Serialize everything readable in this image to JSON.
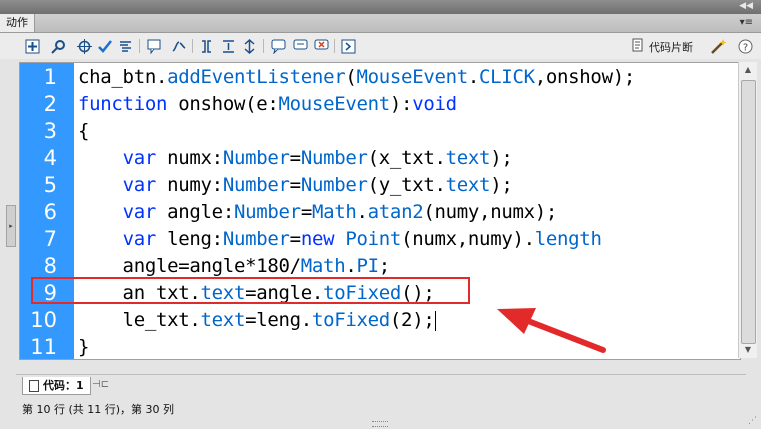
{
  "panel": {
    "tab_label": "动作",
    "title_arrows": "◀◀",
    "menu_icon": "▾≡"
  },
  "toolbar": {
    "icons": [
      "add-icon",
      "find-icon",
      "target-icon",
      "check-syntax-icon",
      "auto-format-icon",
      "code-hint-icon",
      "debug-options-icon",
      "collapse-braces-icon",
      "collapse-selection-icon",
      "expand-all-icon",
      "apply-block-comment-icon",
      "apply-line-comment-icon",
      "remove-comment-icon",
      "show-hide-toolbox-icon"
    ],
    "snippet_label": "代码片断",
    "wand_icon": "wand-icon",
    "help_icon": "help-icon"
  },
  "editor": {
    "lines": [
      {
        "num": "1",
        "tokens": [
          [
            "pl",
            "cha_btn."
          ],
          [
            "fn",
            "addEventListener"
          ],
          [
            "pl",
            "("
          ],
          [
            "fn",
            "MouseEvent"
          ],
          [
            "pl",
            "."
          ],
          [
            "fn",
            "CLICK"
          ],
          [
            "pl",
            ",onshow);"
          ]
        ]
      },
      {
        "num": "2",
        "tokens": [
          [
            "kw",
            "function"
          ],
          [
            "pl",
            " onshow(e:"
          ],
          [
            "fn",
            "MouseEvent"
          ],
          [
            "pl",
            "):"
          ],
          [
            "kw",
            "void"
          ]
        ]
      },
      {
        "num": "3",
        "tokens": [
          [
            "pl",
            "{"
          ]
        ]
      },
      {
        "num": "4",
        "tokens": [
          [
            "pl",
            "    "
          ],
          [
            "kw",
            "var"
          ],
          [
            "pl",
            " numx:"
          ],
          [
            "fn",
            "Number"
          ],
          [
            "pl",
            "="
          ],
          [
            "fn",
            "Number"
          ],
          [
            "pl",
            "(x_txt."
          ],
          [
            "fn",
            "text"
          ],
          [
            "pl",
            ");"
          ]
        ]
      },
      {
        "num": "5",
        "tokens": [
          [
            "pl",
            "    "
          ],
          [
            "kw",
            "var"
          ],
          [
            "pl",
            " numy:"
          ],
          [
            "fn",
            "Number"
          ],
          [
            "pl",
            "="
          ],
          [
            "fn",
            "Number"
          ],
          [
            "pl",
            "(y_txt."
          ],
          [
            "fn",
            "text"
          ],
          [
            "pl",
            ");"
          ]
        ]
      },
      {
        "num": "6",
        "tokens": [
          [
            "pl",
            "    "
          ],
          [
            "kw",
            "var"
          ],
          [
            "pl",
            " angle:"
          ],
          [
            "fn",
            "Number"
          ],
          [
            "pl",
            "="
          ],
          [
            "fn",
            "Math"
          ],
          [
            "pl",
            "."
          ],
          [
            "fn",
            "atan2"
          ],
          [
            "pl",
            "(numy,numx);"
          ]
        ]
      },
      {
        "num": "7",
        "tokens": [
          [
            "pl",
            "    "
          ],
          [
            "kw",
            "var"
          ],
          [
            "pl",
            " leng:"
          ],
          [
            "fn",
            "Number"
          ],
          [
            "pl",
            "="
          ],
          [
            "kw",
            "new"
          ],
          [
            "pl",
            " "
          ],
          [
            "fn",
            "Point"
          ],
          [
            "pl",
            "(numx,numy)."
          ],
          [
            "fn",
            "length"
          ]
        ]
      },
      {
        "num": "8",
        "tokens": [
          [
            "pl",
            "    angle=angle*180/"
          ],
          [
            "fn",
            "Math"
          ],
          [
            "pl",
            "."
          ],
          [
            "fn",
            "PI"
          ],
          [
            "pl",
            ";"
          ]
        ]
      },
      {
        "num": "9",
        "tokens": [
          [
            "pl",
            "    an_txt."
          ],
          [
            "fn",
            "text"
          ],
          [
            "pl",
            "=angle."
          ],
          [
            "fn",
            "toFixed"
          ],
          [
            "pl",
            "();"
          ]
        ]
      },
      {
        "num": "10",
        "tokens": [
          [
            "pl",
            "    le_txt."
          ],
          [
            "fn",
            "text"
          ],
          [
            "pl",
            "=leng."
          ],
          [
            "fn",
            "toFixed"
          ],
          [
            "pl",
            "(2);"
          ]
        ]
      },
      {
        "num": "11",
        "tokens": [
          [
            "pl",
            "}"
          ]
        ]
      }
    ],
    "cursor_line": 10
  },
  "annotation": {
    "highlight_color": "#e32a2a"
  },
  "colors": {
    "gutter": "#3399ff",
    "keyword": "#0033ff",
    "type": "#0066cc"
  },
  "footer": {
    "code_tab_label": "代码：1",
    "status_text": "第 10 行 (共 11 行)，第 30 列"
  }
}
